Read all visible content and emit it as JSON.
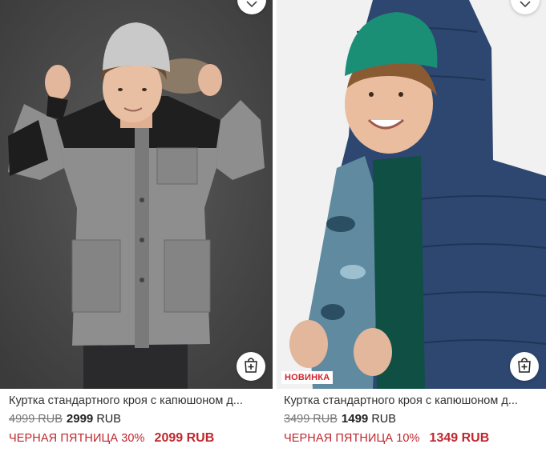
{
  "products": [
    {
      "title": "Куртка стандартного кроя с капюшоном д...",
      "old_price": "4999 RUB",
      "new_price_value": "2999",
      "new_price_currency": "RUB",
      "promo_text": "ЧЕРНАЯ ПЯТНИЦА 30%",
      "promo_price": "2099 RUB",
      "badge": ""
    },
    {
      "title": "Куртка стандартного кроя с капюшоном д...",
      "old_price": "3499 RUB",
      "new_price_value": "1499",
      "new_price_currency": "RUB",
      "promo_text": "ЧЕРНАЯ ПЯТНИЦА 10%",
      "promo_price": "1349 RUB",
      "badge": "НОВИНКА"
    }
  ],
  "colors": {
    "promo": "#c0262d",
    "badge": "#d2232a"
  },
  "icons": {
    "favorite": "chevron-heart-icon",
    "cart": "shopping-bag-plus-icon"
  }
}
